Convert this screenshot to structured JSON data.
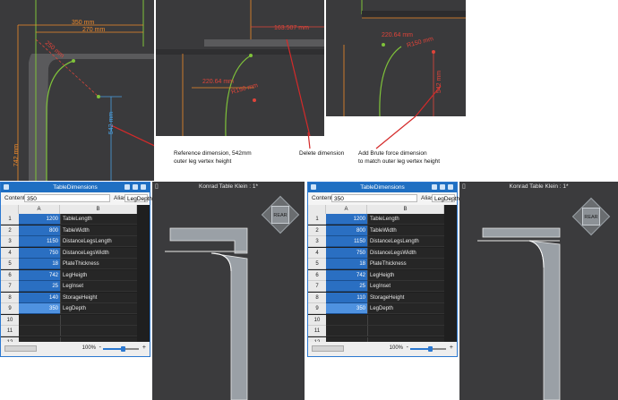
{
  "panel1": {
    "dim_top1": "350 mm",
    "dim_top2": "270 mm",
    "dim_diag": "250 mm",
    "dim_left": "742 mm",
    "dim_vertex": "542 mm"
  },
  "panel2": {
    "dim_top": "163.507 mm",
    "dim_radius": "220.64 mm",
    "dim_r": "R150 mm"
  },
  "panel3": {
    "dim_radius": "220.64 mm",
    "dim_r": "R150 mm",
    "dim_vert": "542 mm"
  },
  "annotations": {
    "a1": "Reference dimension, 542mm\nouter leg vertex height",
    "a2": "Delete dimension",
    "a3": "Add Brute force dimension\nto match outer leg vertex height"
  },
  "left_window": {
    "title": "TableDimensions",
    "content_label": "Content:",
    "content_value": "350",
    "alias_label": "Alias:",
    "alias_value": "LegDepth",
    "col_a": "A",
    "col_b": "B",
    "rows": [
      {
        "n": "1",
        "a": "1200",
        "b": "TableLength"
      },
      {
        "n": "2",
        "a": "800",
        "b": "TableWidth"
      },
      {
        "n": "3",
        "a": "1150",
        "b": "DistanceLegsLength"
      },
      {
        "n": "4",
        "a": "750",
        "b": "DistanceLegsWidth"
      },
      {
        "n": "5",
        "a": "18",
        "b": "PlateThickness"
      },
      {
        "n": "6",
        "a": "742",
        "b": "LegHeigth"
      },
      {
        "n": "7",
        "a": "25",
        "b": "LegInset"
      },
      {
        "n": "8",
        "a": "140",
        "b": "StorageHeight"
      },
      {
        "n": "9",
        "a": "350",
        "b": "LegDepth"
      },
      {
        "n": "10",
        "a": "",
        "b": ""
      },
      {
        "n": "11",
        "a": "",
        "b": ""
      },
      {
        "n": "12",
        "a": "",
        "b": ""
      }
    ],
    "zoom": "100%",
    "zoom_minus": "-",
    "zoom_plus": "+"
  },
  "left_view": {
    "title": "Konrad Table Klein : 1*",
    "cube_label": "REAR"
  },
  "right_window": {
    "title": "TableDimensions",
    "content_label": "Content:",
    "content_value": "350",
    "alias_label": "Alias:",
    "alias_value": "LegDepth",
    "col_a": "A",
    "col_b": "B",
    "rows": [
      {
        "n": "1",
        "a": "1200",
        "b": "TableLength"
      },
      {
        "n": "2",
        "a": "800",
        "b": "TableWidth"
      },
      {
        "n": "3",
        "a": "1150",
        "b": "DistanceLegsLength"
      },
      {
        "n": "4",
        "a": "750",
        "b": "DistanceLegsWidth"
      },
      {
        "n": "5",
        "a": "18",
        "b": "PlateThickness"
      },
      {
        "n": "6",
        "a": "742",
        "b": "LegHeigth"
      },
      {
        "n": "7",
        "a": "25",
        "b": "LegInset"
      },
      {
        "n": "8",
        "a": "110",
        "b": "StorageHeight"
      },
      {
        "n": "9",
        "a": "350",
        "b": "LegDepth"
      },
      {
        "n": "10",
        "a": "",
        "b": ""
      },
      {
        "n": "11",
        "a": "",
        "b": ""
      },
      {
        "n": "12",
        "a": "",
        "b": ""
      }
    ],
    "zoom": "100%",
    "zoom_minus": "-",
    "zoom_plus": "+"
  },
  "right_view": {
    "title": "Konrad Table Klein : 1*",
    "cube_label": "REAR"
  },
  "colors": {
    "dimension_orange": "#f08a2a",
    "dimension_red": "#e0443a",
    "dimension_blue": "#4aa0e0",
    "curve_green": "#7fc23a",
    "selection_blue": "#2a6fc2"
  }
}
